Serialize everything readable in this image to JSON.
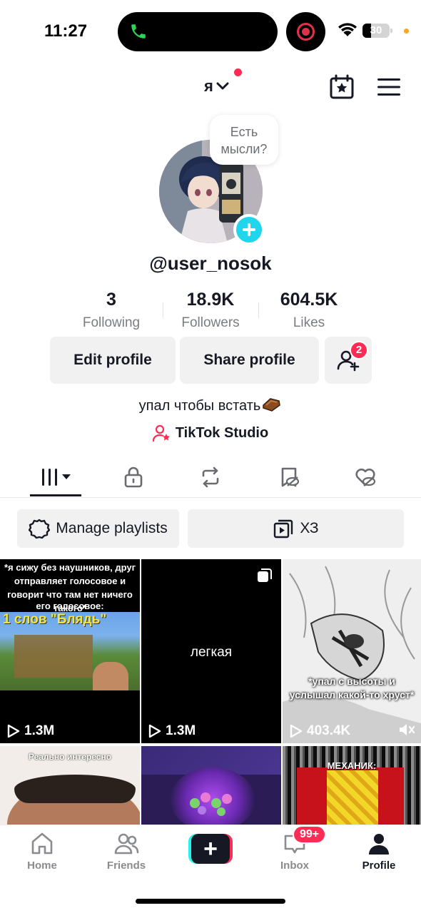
{
  "status_bar": {
    "time": "11:27",
    "battery": "30",
    "battery_level": 0.3
  },
  "header": {
    "account_name": "я",
    "icons": [
      "chevron-down-icon",
      "calendar-star-icon",
      "menu-icon"
    ]
  },
  "profile": {
    "thought_bubble": "Есть мысли?",
    "username": "@user_nosok",
    "stats": {
      "following": {
        "value": "3",
        "label": "Following"
      },
      "followers": {
        "value": "18.9K",
        "label": "Followers"
      },
      "likes": {
        "value": "604.5K",
        "label": "Likes"
      }
    },
    "buttons": {
      "edit": "Edit profile",
      "share": "Share profile",
      "friends_badge": "2"
    },
    "bio": "упал чтобы встать",
    "studio_link": "TikTok Studio"
  },
  "tabs": [
    "videos-grid-icon",
    "lock-icon",
    "repost-icon",
    "favorites-icon",
    "liked-icon"
  ],
  "playlists": {
    "manage": "Manage playlists",
    "playlist_name": "ХЗ"
  },
  "videos": [
    {
      "caption": "*я сижу без наушников, друг отправляет голосовое и говорит что там нет ничего такого*",
      "sub_caption": "его голосовое:",
      "overlay": "1 слов \"Блядь\"",
      "views": "1.3M"
    },
    {
      "caption": "легкая",
      "views": "1.3M"
    },
    {
      "caption": "*упал с высоты и услышал какой-то хруст*",
      "views": "403.4K"
    },
    {
      "caption": "Реально интересно"
    },
    {
      "caption": ""
    },
    {
      "caption": "МЕХАНИК:"
    }
  ],
  "bottom_nav": {
    "home": "Home",
    "friends": "Friends",
    "create": "+",
    "inbox": "Inbox",
    "inbox_badge": "99+",
    "profile": "Profile"
  },
  "colors": {
    "accent": "#fe2c55",
    "cyan": "#20d5ec",
    "text": "#161823",
    "muted": "#7a7c83"
  }
}
